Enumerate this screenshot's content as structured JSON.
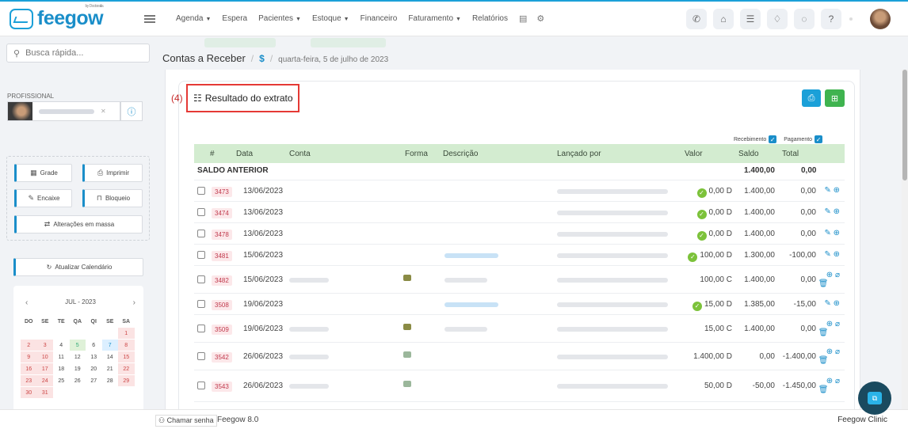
{
  "app": {
    "logo": "feegow",
    "logo_sub": "by Doctoralia"
  },
  "nav": {
    "items": [
      {
        "label": "Agenda",
        "dropdown": true
      },
      {
        "label": "Espera",
        "dropdown": false
      },
      {
        "label": "Pacientes",
        "dropdown": true
      },
      {
        "label": "Estoque",
        "dropdown": true
      },
      {
        "label": "Financeiro",
        "dropdown": false
      },
      {
        "label": "Faturamento",
        "dropdown": true
      },
      {
        "label": "Relatórios",
        "dropdown": false
      }
    ],
    "right_icons": [
      "phone-icon",
      "inbox-icon",
      "list-icon",
      "bell-icon",
      "chat-icon",
      "help-icon"
    ]
  },
  "sidebar": {
    "search_placeholder": "Busca rápida...",
    "profissional_label": "PROFISSIONAL",
    "tools": {
      "grade": "Grade",
      "imprimir": "Imprimir",
      "encaixe": "Encaixe",
      "bloqueio": "Bloqueio",
      "alteracoes": "Alterações em massa"
    },
    "update_calendar": "Atualizar Calendário",
    "calendar": {
      "month": "JUL - 2023",
      "weekdays": [
        "DO",
        "SE",
        "TE",
        "QA",
        "QI",
        "SE",
        "SA"
      ],
      "weeks": [
        [
          {
            "d": ""
          },
          {
            "d": ""
          },
          {
            "d": ""
          },
          {
            "d": ""
          },
          {
            "d": ""
          },
          {
            "d": ""
          },
          {
            "d": "1",
            "s": "red"
          }
        ],
        [
          {
            "d": "2",
            "s": "red"
          },
          {
            "d": "3",
            "s": "red"
          },
          {
            "d": "4"
          },
          {
            "d": "5",
            "s": "green"
          },
          {
            "d": "6"
          },
          {
            "d": "7",
            "s": "blue"
          },
          {
            "d": "8",
            "s": "red"
          }
        ],
        [
          {
            "d": "9",
            "s": "red"
          },
          {
            "d": "10",
            "s": "red"
          },
          {
            "d": "11"
          },
          {
            "d": "12"
          },
          {
            "d": "13"
          },
          {
            "d": "14"
          },
          {
            "d": "15",
            "s": "red"
          }
        ],
        [
          {
            "d": "16",
            "s": "red"
          },
          {
            "d": "17",
            "s": "red"
          },
          {
            "d": "18"
          },
          {
            "d": "19"
          },
          {
            "d": "20"
          },
          {
            "d": "21"
          },
          {
            "d": "22",
            "s": "red"
          }
        ],
        [
          {
            "d": "23",
            "s": "red"
          },
          {
            "d": "24",
            "s": "red"
          },
          {
            "d": "25"
          },
          {
            "d": "26"
          },
          {
            "d": "27"
          },
          {
            "d": "28"
          },
          {
            "d": "29",
            "s": "red"
          }
        ],
        [
          {
            "d": "30",
            "s": "red"
          },
          {
            "d": "31",
            "s": "red"
          },
          {
            "d": ""
          },
          {
            "d": ""
          },
          {
            "d": ""
          },
          {
            "d": ""
          },
          {
            "d": ""
          }
        ]
      ]
    }
  },
  "breadcrumb": {
    "title": "Contas a Receber",
    "icon": "$",
    "date": "quarta-feira, 5 de julho de 2023"
  },
  "annotation": {
    "number": "(4)",
    "title": "Resultado do extrato"
  },
  "filters": {
    "recebimento": "Recebimento",
    "pagamento": "Pagamento"
  },
  "table": {
    "headers": {
      "num": "#",
      "data": "Data",
      "conta": "Conta",
      "forma": "Forma",
      "descricao": "Descrição",
      "lancado": "Lançado por",
      "valor": "Valor",
      "saldo": "Saldo",
      "total": "Total"
    },
    "saldo_anterior": {
      "label": "SALDO ANTERIOR",
      "saldo": "1.400,00",
      "total": "0,00"
    },
    "rows": [
      {
        "id": "3473",
        "data": "13/06/2023",
        "valor": "0,00 D",
        "ok": true,
        "saldo": "1.400,00",
        "total": "0,00"
      },
      {
        "id": "3474",
        "data": "13/06/2023",
        "valor": "0,00 D",
        "ok": true,
        "saldo": "1.400,00",
        "total": "0,00"
      },
      {
        "id": "3478",
        "data": "13/06/2023",
        "valor": "0,00 D",
        "ok": true,
        "saldo": "1.400,00",
        "total": "0,00"
      },
      {
        "id": "3481",
        "data": "15/06/2023",
        "valor": "100,00 D",
        "ok": true,
        "saldo": "1.300,00",
        "total": "-100,00"
      },
      {
        "id": "3482",
        "data": "15/06/2023",
        "valor": "100,00 C",
        "ok": false,
        "saldo": "1.400,00",
        "total": "0,00"
      },
      {
        "id": "3508",
        "data": "19/06/2023",
        "valor": "15,00 D",
        "ok": true,
        "saldo": "1.385,00",
        "total": "-15,00"
      },
      {
        "id": "3509",
        "data": "19/06/2023",
        "valor": "15,00 C",
        "ok": false,
        "saldo": "1.400,00",
        "total": "0,00"
      },
      {
        "id": "3542",
        "data": "26/06/2023",
        "valor": "1.400,00 D",
        "ok": false,
        "saldo": "0,00",
        "total": "-1.400,00"
      },
      {
        "id": "3543",
        "data": "26/06/2023",
        "valor": "50,00 D",
        "ok": false,
        "saldo": "-50,00",
        "total": "-1.450,00"
      }
    ]
  },
  "footer": {
    "chamar": "Chamar senha",
    "version": "Feegow 8.0",
    "clinic": "Feegow Clinic"
  },
  "colors": {
    "accent": "#1a8ec9",
    "success": "#3fb34f",
    "annotation": "#e53935",
    "table_header": "#d3ecd0"
  }
}
